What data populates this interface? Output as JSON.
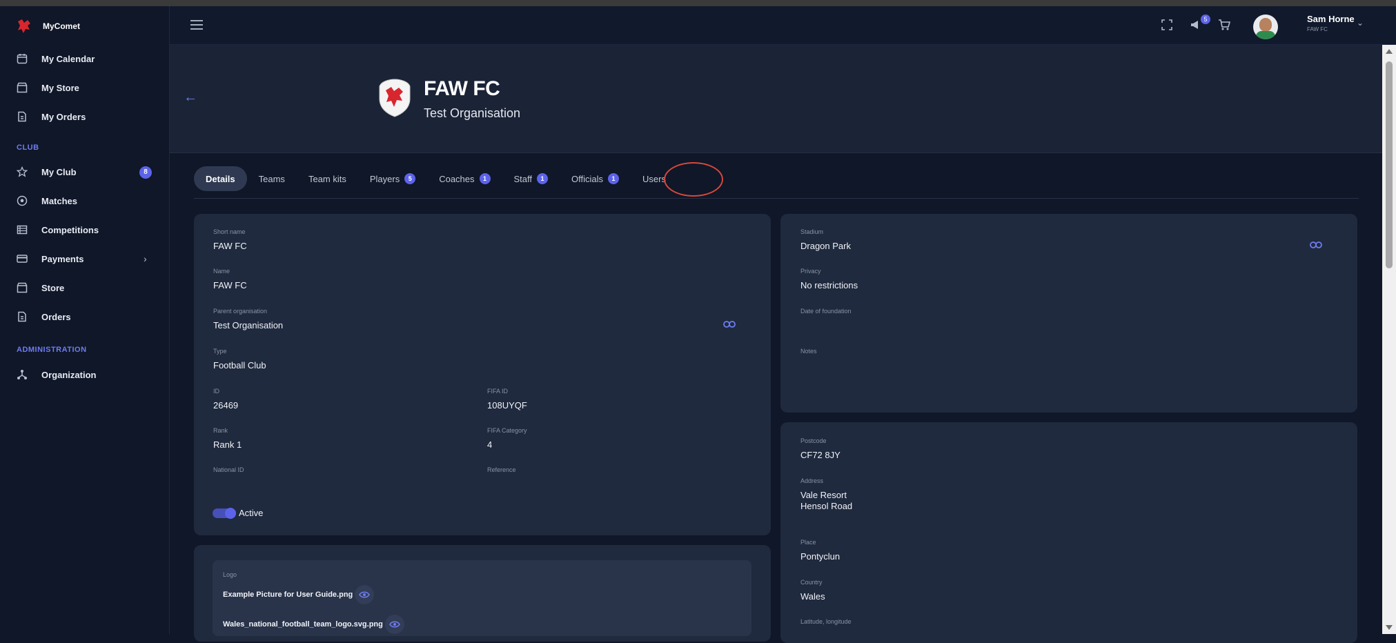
{
  "app": {
    "name": "MyComet"
  },
  "sidebar": {
    "items_top": [
      {
        "label": "My Calendar",
        "icon": "calendar-icon"
      },
      {
        "label": "My Store",
        "icon": "store-icon"
      },
      {
        "label": "My Orders",
        "icon": "orders-icon"
      }
    ],
    "club_section": "CLUB",
    "club_items": [
      {
        "label": "My Club",
        "icon": "star-icon",
        "badge": "8"
      },
      {
        "label": "Matches",
        "icon": "football-icon"
      },
      {
        "label": "Competitions",
        "icon": "list-icon"
      },
      {
        "label": "Payments",
        "icon": "card-icon"
      },
      {
        "label": "Store",
        "icon": "store-icon"
      },
      {
        "label": "Orders",
        "icon": "orders-icon"
      }
    ],
    "admin_section": "ADMINISTRATION",
    "admin_items": [
      {
        "label": "Organization",
        "icon": "hierarchy-icon"
      }
    ]
  },
  "topbar": {
    "notification_count": "5",
    "user": {
      "name": "Sam Horne",
      "club": "FAW FC"
    }
  },
  "header": {
    "title": "FAW FC",
    "subtitle": "Test Organisation"
  },
  "tabs": [
    {
      "label": "Details",
      "active": true
    },
    {
      "label": "Teams"
    },
    {
      "label": "Team kits"
    },
    {
      "label": "Players",
      "badge": "5"
    },
    {
      "label": "Coaches",
      "badge": "1"
    },
    {
      "label": "Staff",
      "badge": "1"
    },
    {
      "label": "Officials",
      "badge": "1"
    },
    {
      "label": "Users"
    }
  ],
  "details": {
    "short_name_label": "Short name",
    "short_name": "FAW FC",
    "name_label": "Name",
    "name": "FAW FC",
    "parent_label": "Parent organisation",
    "parent": "Test Organisation",
    "type_label": "Type",
    "type": "Football Club",
    "id_label": "ID",
    "id": "26469",
    "fifa_id_label": "FIFA ID",
    "fifa_id": "108UYQF",
    "rank_label": "Rank",
    "rank": "Rank 1",
    "fifa_category_label": "FIFA Category",
    "fifa_category": "4",
    "national_id_label": "National ID",
    "reference_label": "Reference",
    "active_label": "Active"
  },
  "extra": {
    "stadium_label": "Stadium",
    "stadium": "Dragon Park",
    "privacy_label": "Privacy",
    "privacy": "No restrictions",
    "foundation_label": "Date of foundation",
    "notes_label": "Notes"
  },
  "address": {
    "postcode_label": "Postcode",
    "postcode": "CF72 8JY",
    "address_label": "Address",
    "address_line1": "Vale Resort",
    "address_line2": "Hensol Road",
    "place_label": "Place",
    "place": "Pontyclun",
    "country_label": "Country",
    "country": "Wales",
    "latlong_label": "Latitude, longitude"
  },
  "logo": {
    "label": "Logo",
    "files": [
      "Example Picture for User Guide.png",
      "Wales_national_football_team_logo.svg.png"
    ]
  },
  "colors": {
    "accent": "#5c63ea",
    "highlight_circle": "#d9473b",
    "background": "#0f1728"
  }
}
